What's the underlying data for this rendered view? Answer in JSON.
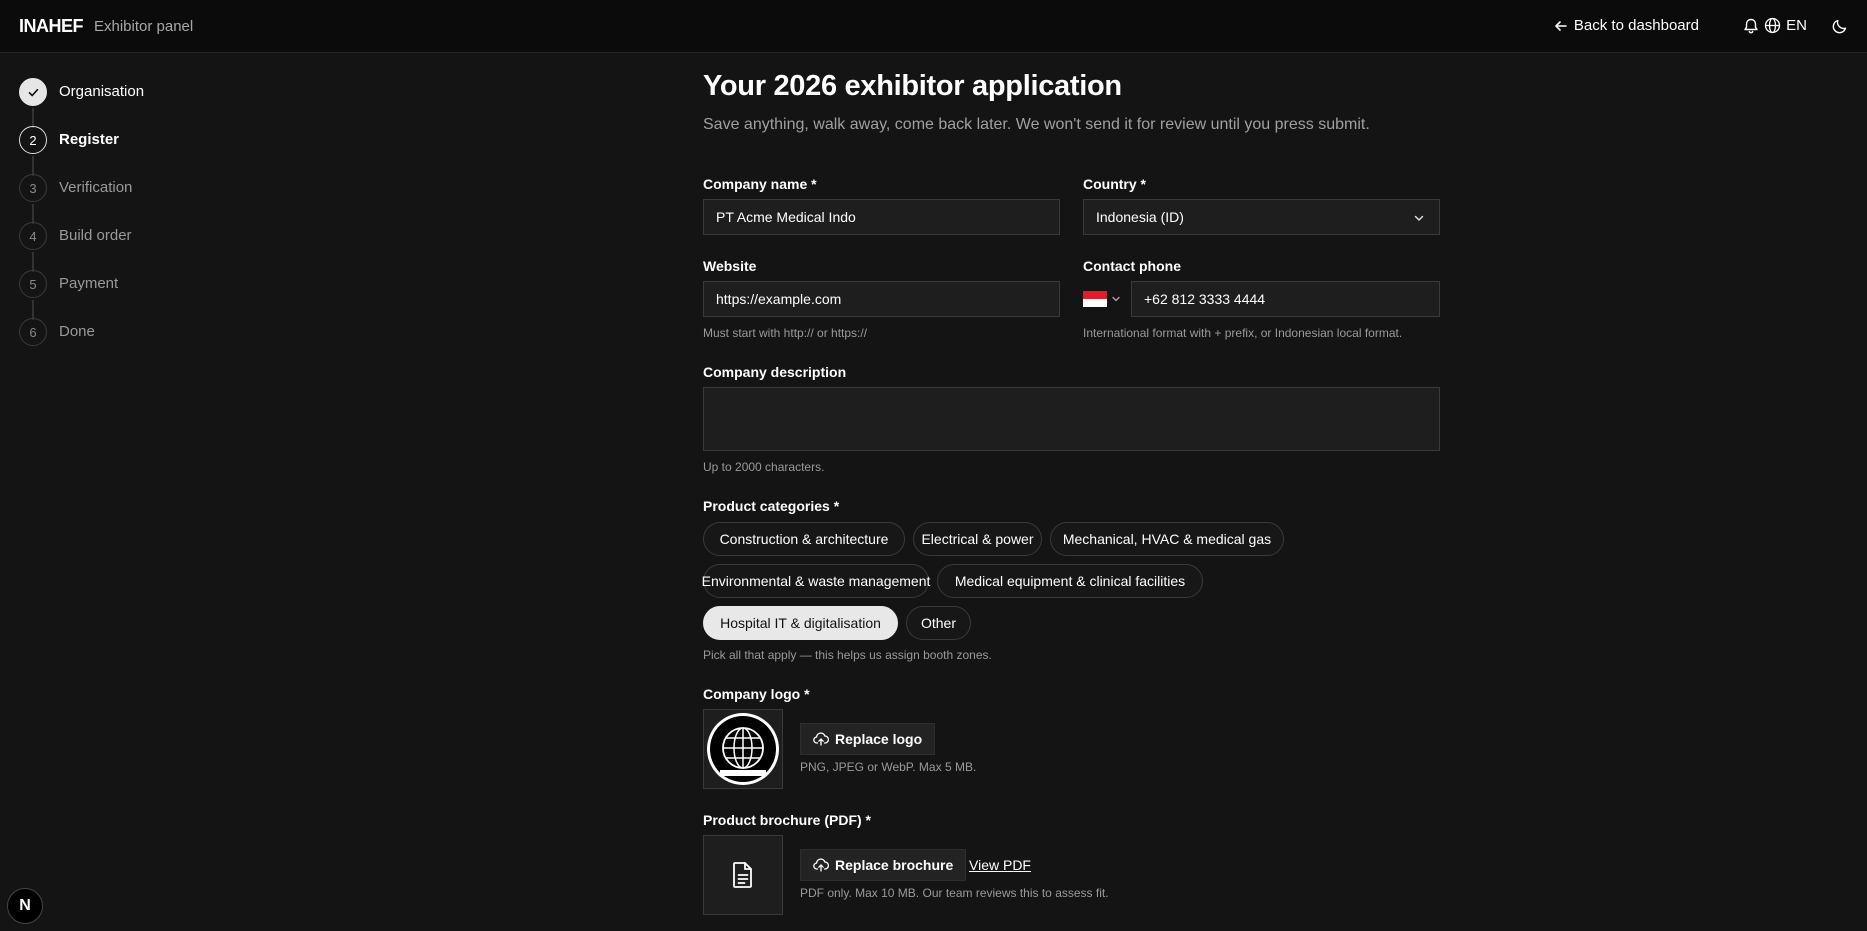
{
  "header": {
    "brand": "INAHEF",
    "panel": "Exhibitor panel",
    "back_label": "Back to dashboard",
    "language": "EN"
  },
  "steps": [
    {
      "num": "",
      "label": "Organisation",
      "state": "done"
    },
    {
      "num": "2",
      "label": "Register",
      "state": "active"
    },
    {
      "num": "3",
      "label": "Verification",
      "state": "pending"
    },
    {
      "num": "4",
      "label": "Build order",
      "state": "pending"
    },
    {
      "num": "5",
      "label": "Payment",
      "state": "pending"
    },
    {
      "num": "6",
      "label": "Done",
      "state": "pending"
    }
  ],
  "page": {
    "title": "Your 2026 exhibitor application",
    "subtitle": "Save anything, walk away, come back later. We won't send it for review until you press submit."
  },
  "form": {
    "company_name": {
      "label": "Company name *",
      "value": "PT Acme Medical Indo"
    },
    "country": {
      "label": "Country *",
      "value": "Indonesia (ID)"
    },
    "website": {
      "label": "Website",
      "value": "https://example.com",
      "hint": "Must start with http:// or https://"
    },
    "phone": {
      "label": "Contact phone",
      "value": "+62 812 3333 4444",
      "hint": "International format with + prefix, or Indonesian local format."
    },
    "description": {
      "label": "Company description",
      "value": "",
      "hint": "Up to 2000 characters."
    },
    "categories": {
      "label": "Product categories *",
      "hint": "Pick all that apply — this helps us assign booth zones.",
      "items": [
        "Construction & architecture",
        "Electrical & power",
        "Mechanical, HVAC & medical gas",
        "Environmental & waste management",
        "Medical equipment & clinical facilities",
        "Hospital IT & digitalisation",
        "Other"
      ],
      "selected": "Hospital IT & digitalisation"
    },
    "logo": {
      "label": "Company logo *",
      "button": "Replace logo",
      "hint": "PNG, JPEG or WebP. Max 5 MB."
    },
    "brochure": {
      "label": "Product brochure (PDF) *",
      "button": "Replace brochure",
      "view": "View PDF",
      "hint": "PDF only. Max 10 MB. Our team reviews this to assess fit."
    }
  },
  "dev_badge": "N",
  "colors": {
    "background": "#141414",
    "topbar": "#0b0b0b",
    "field": "#1e1e1e",
    "chip_selected": "#e8e8e8"
  }
}
